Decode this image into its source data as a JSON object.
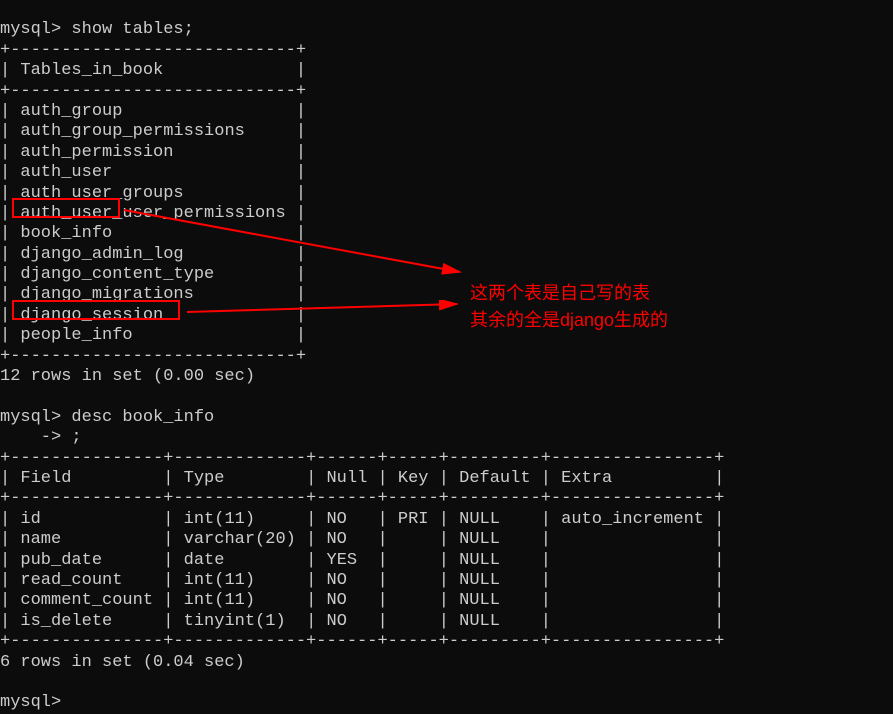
{
  "prompt1": "mysql> show tables;",
  "tables_header": "Tables_in_book",
  "tables": [
    "auth_group",
    "auth_group_permissions",
    "auth_permission",
    "auth_user",
    "auth_user_groups",
    "auth_user_user_permissions",
    "book_info",
    "django_admin_log",
    "django_content_type",
    "django_migrations",
    "django_session",
    "people_info"
  ],
  "result1": "12 rows in set (0.00 sec)",
  "prompt2_line1": "mysql> desc book_info",
  "prompt2_line2": "    -> ;",
  "desc_headers": {
    "field": "Field",
    "type": "Type",
    "null": "Null",
    "key": "Key",
    "default": "Default",
    "extra": "Extra"
  },
  "desc_rows": [
    {
      "field": "id",
      "type": "int(11)",
      "null": "NO",
      "key": "PRI",
      "default": "NULL",
      "extra": "auto_increment"
    },
    {
      "field": "name",
      "type": "varchar(20)",
      "null": "NO",
      "key": "",
      "default": "NULL",
      "extra": ""
    },
    {
      "field": "pub_date",
      "type": "date",
      "null": "YES",
      "key": "",
      "default": "NULL",
      "extra": ""
    },
    {
      "field": "read_count",
      "type": "int(11)",
      "null": "NO",
      "key": "",
      "default": "NULL",
      "extra": ""
    },
    {
      "field": "comment_count",
      "type": "int(11)",
      "null": "NO",
      "key": "",
      "default": "NULL",
      "extra": ""
    },
    {
      "field": "is_delete",
      "type": "tinyint(1)",
      "null": "NO",
      "key": "",
      "default": "NULL",
      "extra": ""
    }
  ],
  "result2": "6 rows in set (0.04 sec)",
  "prompt3": "mysql>",
  "annotation_line1": "这两个表是自己写的表",
  "annotation_line2": "其余的全是django生成的",
  "border_separator_short": "+----------------------------+",
  "border_separator_long": "+---------------+-------------+------+-----+---------+----------------+"
}
